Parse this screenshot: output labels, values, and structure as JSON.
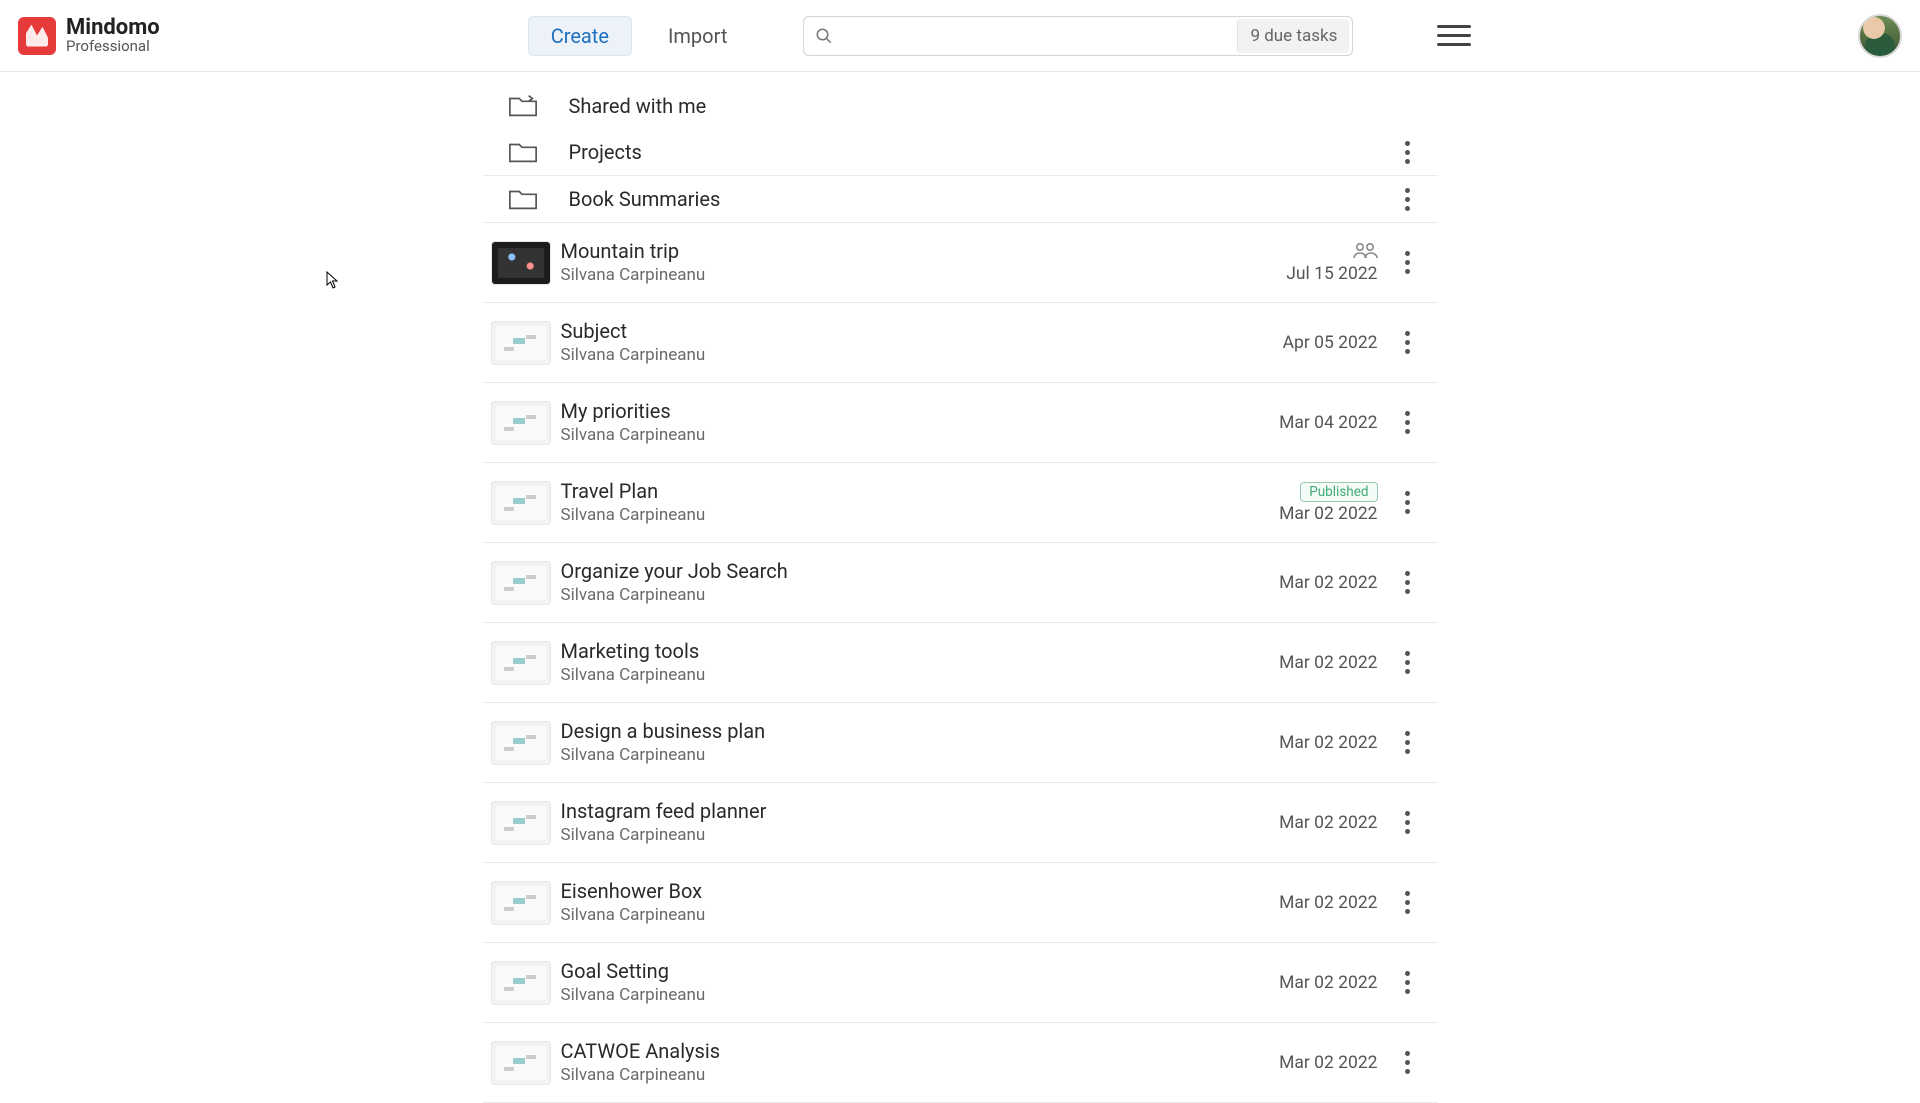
{
  "brand": {
    "name": "Mindomo",
    "tier": "Professional"
  },
  "header": {
    "create_label": "Create",
    "import_label": "Import",
    "search_placeholder": "",
    "due_tasks_label": "9 due tasks"
  },
  "sections": {
    "shared": {
      "label": "Shared with me"
    },
    "folders": [
      {
        "label": "Projects"
      },
      {
        "label": "Book Summaries"
      }
    ]
  },
  "owner": "Silvana Carpineanu",
  "badges": {
    "published": "Published"
  },
  "maps": [
    {
      "title": "Mountain trip",
      "date": "Jul 15 2022",
      "shared": true,
      "published": false,
      "thumb": "dark"
    },
    {
      "title": "Subject",
      "date": "Apr 05 2022",
      "shared": false,
      "published": false,
      "thumb": "mind"
    },
    {
      "title": "My priorities",
      "date": "Mar 04 2022",
      "shared": false,
      "published": false,
      "thumb": "mind"
    },
    {
      "title": "Travel Plan",
      "date": "Mar 02 2022",
      "shared": false,
      "published": true,
      "thumb": "mind"
    },
    {
      "title": "Organize your Job Search",
      "date": "Mar 02 2022",
      "shared": false,
      "published": false,
      "thumb": "mind"
    },
    {
      "title": "Marketing tools",
      "date": "Mar 02 2022",
      "shared": false,
      "published": false,
      "thumb": "mind"
    },
    {
      "title": "Design a business plan",
      "date": "Mar 02 2022",
      "shared": false,
      "published": false,
      "thumb": "mind"
    },
    {
      "title": "Instagram feed planner",
      "date": "Mar 02 2022",
      "shared": false,
      "published": false,
      "thumb": "mind"
    },
    {
      "title": "Eisenhower Box",
      "date": "Mar 02 2022",
      "shared": false,
      "published": false,
      "thumb": "mind"
    },
    {
      "title": "Goal Setting",
      "date": "Mar 02 2022",
      "shared": false,
      "published": false,
      "thumb": "mind"
    },
    {
      "title": "CATWOE Analysis",
      "date": "Mar 02 2022",
      "shared": false,
      "published": false,
      "thumb": "mind"
    }
  ]
}
